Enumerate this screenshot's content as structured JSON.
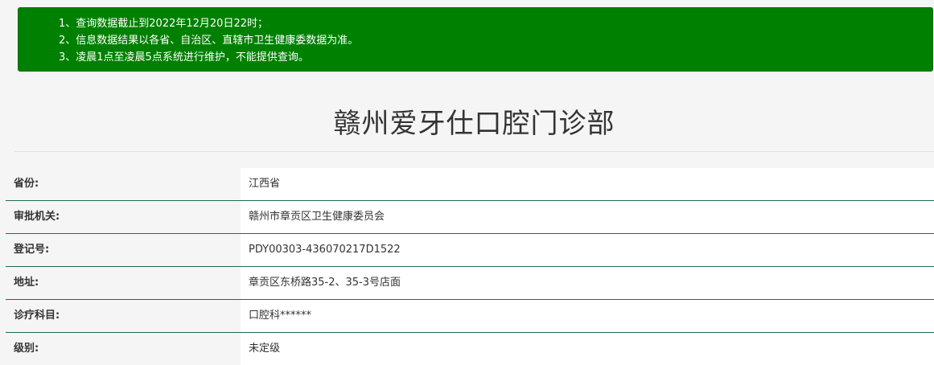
{
  "notice": {
    "lines": [
      "1、查询数据截止到2022年12月20日22时；",
      "2、信息数据结果以各省、自治区、直辖市卫生健康委数据为准。",
      "3、凌晨1点至凌晨5点系统进行维护，不能提供查询。"
    ]
  },
  "title": "赣州爱牙仕口腔门诊部",
  "fields": [
    {
      "label": "省份:",
      "value": "江西省"
    },
    {
      "label": "审批机关:",
      "value": "赣州市章贡区卫生健康委员会"
    },
    {
      "label": "登记号:",
      "value": "PDY00303-436070217D1522"
    },
    {
      "label": "地址:",
      "value": "章贡区东桥路35-2、35-3号店面"
    },
    {
      "label": "诊疗科目:",
      "value": "口腔科******"
    },
    {
      "label": "级别:",
      "value": "未定级"
    }
  ],
  "colors": {
    "notice_bg": "#008000",
    "row_divider": "#1f6b4f",
    "page_bg": "#f5f5f5"
  }
}
